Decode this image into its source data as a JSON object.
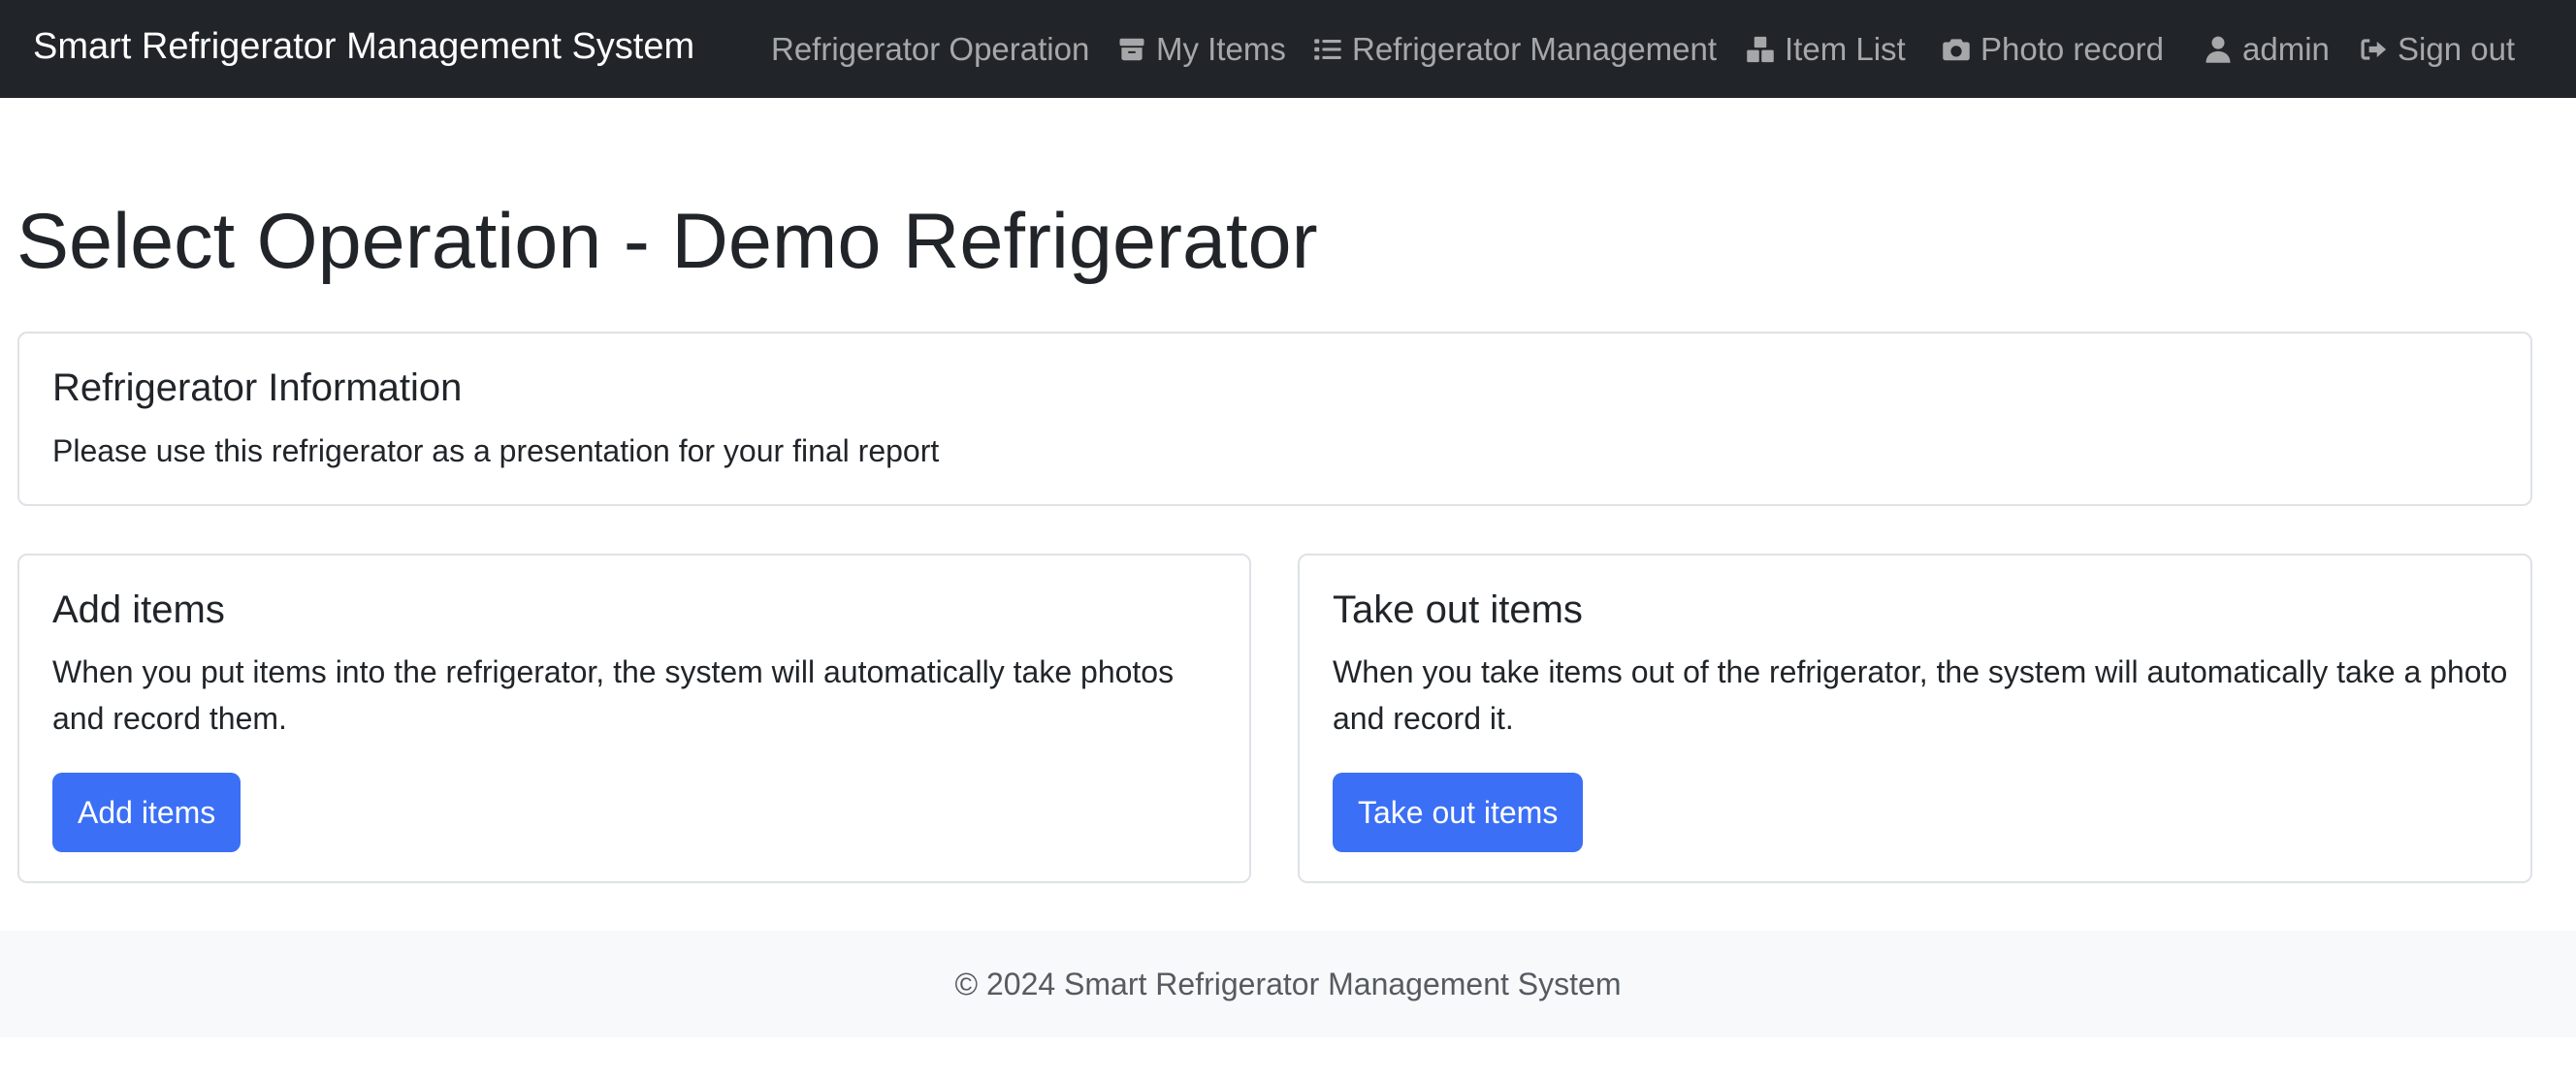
{
  "navbar": {
    "brand": "Smart Refrigerator Management System",
    "items": [
      {
        "label": "Refrigerator Operation",
        "icon": "none"
      },
      {
        "label": "My Items",
        "icon": "box-icon"
      },
      {
        "label": "Refrigerator Management",
        "icon": "list-icon"
      },
      {
        "label": "Item List",
        "icon": "boxes-icon"
      },
      {
        "label": "Photo record",
        "icon": "camera-icon"
      },
      {
        "label": "admin",
        "icon": "user-icon"
      },
      {
        "label": "Sign out",
        "icon": "sign-out-icon"
      }
    ]
  },
  "main": {
    "title": "Select Operation - Demo Refrigerator",
    "info_card": {
      "title": "Refrigerator Information",
      "text": "Please use this refrigerator as a presentation for your final report"
    },
    "add_card": {
      "title": "Add items",
      "text": "When you put items into the refrigerator, the system will automatically take photos and record them.",
      "button": "Add items"
    },
    "take_card": {
      "title": "Take out items",
      "text": "When you take items out of the refrigerator, the system will automatically take a photo and record it.",
      "button": "Take out items"
    }
  },
  "footer": {
    "text": "© 2024 Smart Refrigerator Management System"
  },
  "colors": {
    "navbar_bg": "#212529",
    "primary": "#3b6ff5",
    "footer_bg": "#f8f9fa",
    "border": "#dee2e6"
  }
}
